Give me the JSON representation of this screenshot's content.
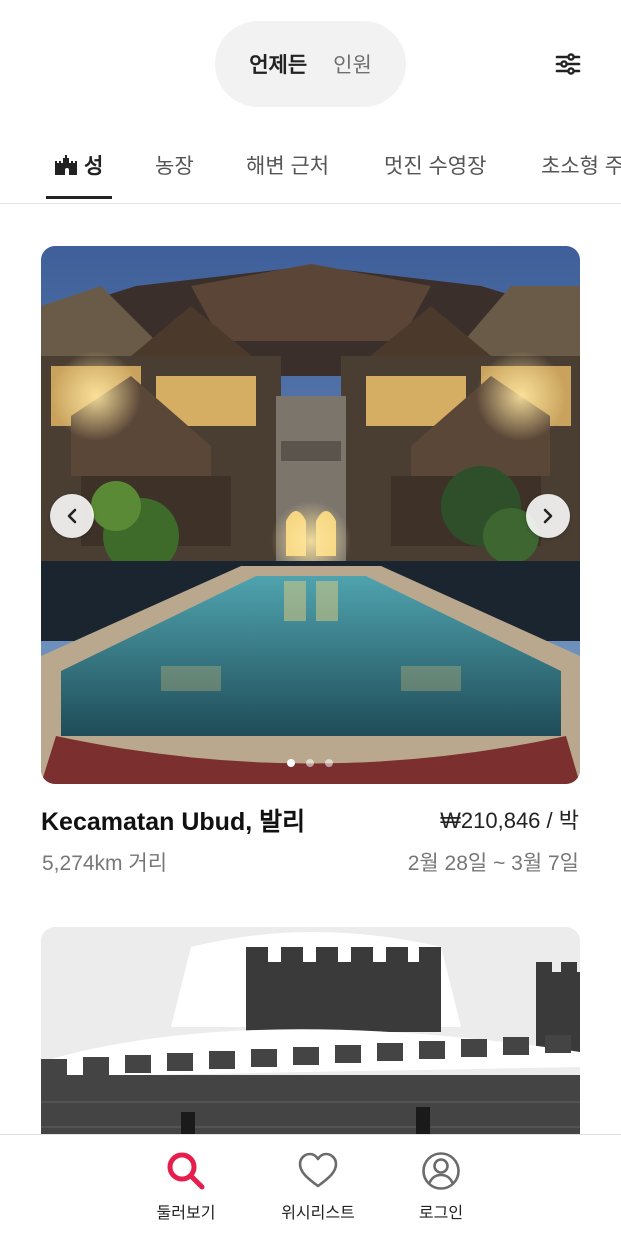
{
  "search": {
    "when_label": "언제든",
    "who_label": "인원"
  },
  "icons": {
    "filter": "sliders-icon",
    "castle": "castle-icon",
    "prev": "chevron-left-icon",
    "next": "chevron-right-icon",
    "explore": "search-icon",
    "wishlist": "heart-icon",
    "login": "user-circle-icon"
  },
  "categories": [
    {
      "label": "성",
      "icon": "castle-icon",
      "active": true
    },
    {
      "label": "농장"
    },
    {
      "label": "해변 근처"
    },
    {
      "label": "멋진 수영장"
    },
    {
      "label": "초소형 주"
    }
  ],
  "listing": {
    "title": "Kecamatan Ubud, 발리",
    "price": "₩210,846 / 박",
    "distance": "5,274km 거리",
    "dates": "2월 28일 ~ 3월 7일",
    "photo_count": 3,
    "current_photo": 1
  },
  "bottom_nav": {
    "explore": "둘러보기",
    "wishlist": "위시리스트",
    "login": "로그인"
  },
  "colors": {
    "accent": "#e61e4d",
    "text_primary": "#222222",
    "text_secondary": "#777777",
    "pill_bg": "#f2f2f2"
  }
}
